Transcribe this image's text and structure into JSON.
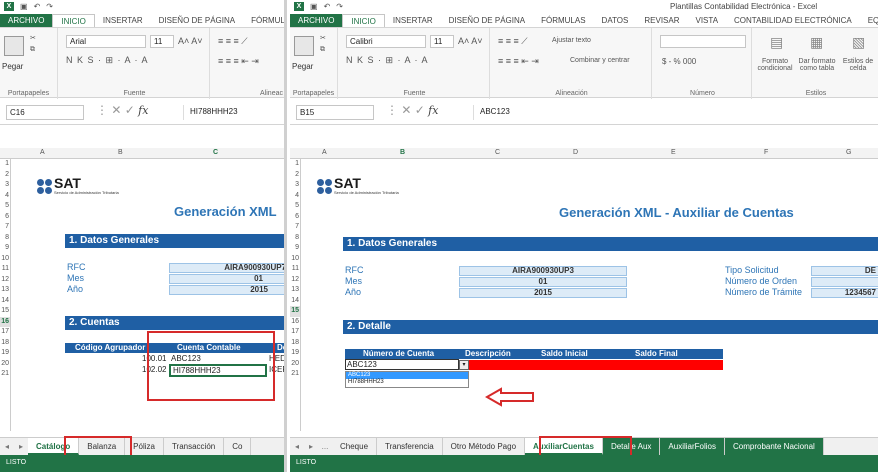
{
  "left": {
    "ribbon_tabs": [
      "ARCHIVO",
      "INICIO",
      "INSERTAR",
      "DISEÑO DE PÁGINA",
      "FÓRMULAS"
    ],
    "font_name": "Arial",
    "font_size": "11",
    "paste_label": "Pegar",
    "group_labels": [
      "Portapapeles",
      "Fuente",
      "Alineac"
    ],
    "name_box": "C16",
    "formula": "HI788HHH23",
    "col_headers": [
      "A",
      "B",
      "C"
    ],
    "rows": [
      "1",
      "2",
      "3",
      "4",
      "5",
      "6",
      "7",
      "8",
      "9",
      "10",
      "11",
      "12",
      "13",
      "14",
      "15",
      "16",
      "17",
      "18",
      "19",
      "20",
      "21"
    ],
    "selected_row": "16",
    "logo_text": "SAT",
    "logo_sub": "Servicio de Administración Tributaria",
    "gen_title": "Generación XML",
    "section1": "1. Datos Generales",
    "rfc_label": "RFC",
    "rfc_value": "AIRA900930UP7",
    "mes_label": "Mes",
    "mes_value": "01",
    "anio_label": "Año",
    "anio_value": "2015",
    "section2": "2. Cuentas",
    "th_codigo": "Código Agrupador",
    "th_cuenta": "Cuenta Contable",
    "th_extra": "De",
    "row15_code": "100.01",
    "row15_acct": "ABC123",
    "row15_extra": "HED",
    "row16_code": "102.02",
    "row16_acct": "HI788HHH23",
    "row16_extra": "ICER",
    "sheet_tabs": [
      "Catálogo",
      "Balanza",
      "Póliza",
      "Transacción",
      "Co"
    ],
    "status": "LISTO"
  },
  "right": {
    "window_title": "Plantillas Contabilidad Electrónica - Excel",
    "ribbon_tabs": [
      "ARCHIVO",
      "INICIO",
      "INSERTAR",
      "DISEÑO DE PÁGINA",
      "FÓRMULAS",
      "DATOS",
      "REVISAR",
      "VISTA",
      "CONTABILIDAD ELECTRÓNICA",
      "EQUIPO"
    ],
    "font_name": "Calibri",
    "font_size": "11",
    "paste_label": "Pegar",
    "wrap_text": "Ajustar texto",
    "merge_center": "Combinar y centrar",
    "number_fmt": "$ - % 000",
    "formato_cond": "Formato condicional",
    "dar_formato": "Dar formato como tabla",
    "estilos_celda": "Estilos de celda",
    "group_labels": [
      "Portapapeles",
      "Fuente",
      "Alineación",
      "Número",
      "Estilos"
    ],
    "name_box": "B15",
    "formula": "ABC123",
    "col_headers": [
      "A",
      "B",
      "C",
      "D",
      "E",
      "F",
      "G"
    ],
    "rows": [
      "1",
      "2",
      "3",
      "4",
      "5",
      "6",
      "7",
      "8",
      "9",
      "10",
      "11",
      "12",
      "13",
      "14",
      "15",
      "16",
      "17",
      "18",
      "19",
      "20",
      "21"
    ],
    "selected_row": "15",
    "logo_text": "SAT",
    "logo_sub": "Servicio de Administración Tributaria",
    "gen_title": "Generación XML - Auxiliar de Cuentas",
    "section1": "1. Datos Generales",
    "rfc_label": "RFC",
    "rfc_value": "AIRA900930UP3",
    "mes_label": "Mes",
    "mes_value": "01",
    "anio_label": "Año",
    "anio_value": "2015",
    "tipo_label": "Tipo Solicitud",
    "tipo_value": "DE",
    "orden_label": "Número de Orden",
    "tramite_label": "Número de Trámite",
    "tramite_value": "1234567",
    "section2": "2. Detalle",
    "th": [
      "Número de Cuenta",
      "Descripción",
      "Saldo Inicial",
      "Saldo Final"
    ],
    "input_value": "ABC123",
    "dropdown_options": [
      "ABC123",
      "HI788HHH23"
    ],
    "sheet_tabs": [
      "Cheque",
      "Transferencia",
      "Otro Método Pago",
      "AuxiliarCuentas",
      "Detalle Aux",
      "AuxiliarFolios",
      "Comprobante Nacional"
    ],
    "more_tabs": "...",
    "status": "LISTO"
  }
}
